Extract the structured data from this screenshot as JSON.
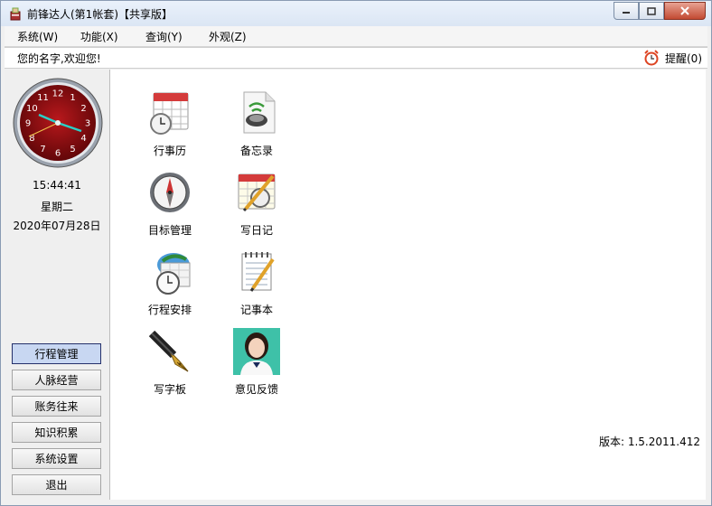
{
  "window": {
    "title": "前锋达人(第1帐套)【共享版】"
  },
  "menu": [
    {
      "label": "系统(W)"
    },
    {
      "label": "功能(X)"
    },
    {
      "label": "查询(Y)"
    },
    {
      "label": "外观(Z)"
    }
  ],
  "info": {
    "welcome": "您的名字,欢迎您!",
    "reminder": "提醒(0)"
  },
  "clock": {
    "numbers": [
      "12",
      "1",
      "2",
      "3",
      "4",
      "5",
      "6",
      "7",
      "8",
      "9",
      "10",
      "11"
    ],
    "time": "15:44:41",
    "weekday": "星期二",
    "date": "2020年07月28日"
  },
  "nav": [
    {
      "label": "行程管理"
    },
    {
      "label": "人脉经营"
    },
    {
      "label": "账务往来"
    },
    {
      "label": "知识积累"
    },
    {
      "label": "系统设置"
    },
    {
      "label": "退出"
    }
  ],
  "tiles": [
    {
      "label": "行事历",
      "icon": "calendar-clock-icon"
    },
    {
      "label": "备忘录",
      "icon": "memo-speaker-icon"
    },
    {
      "label": "目标管理",
      "icon": "compass-icon"
    },
    {
      "label": "写日记",
      "icon": "diary-pencil-icon"
    },
    {
      "label": "行程安排",
      "icon": "schedule-clock-icon"
    },
    {
      "label": "记事本",
      "icon": "notepad-icon"
    },
    {
      "label": "写字板",
      "icon": "fountain-pen-icon"
    },
    {
      "label": "意见反馈",
      "icon": "feedback-agent-icon"
    }
  ],
  "version": "版本: 1.5.2011.412",
  "colors": {
    "clock_face": "#8b0d10",
    "accent": "#25306b"
  }
}
